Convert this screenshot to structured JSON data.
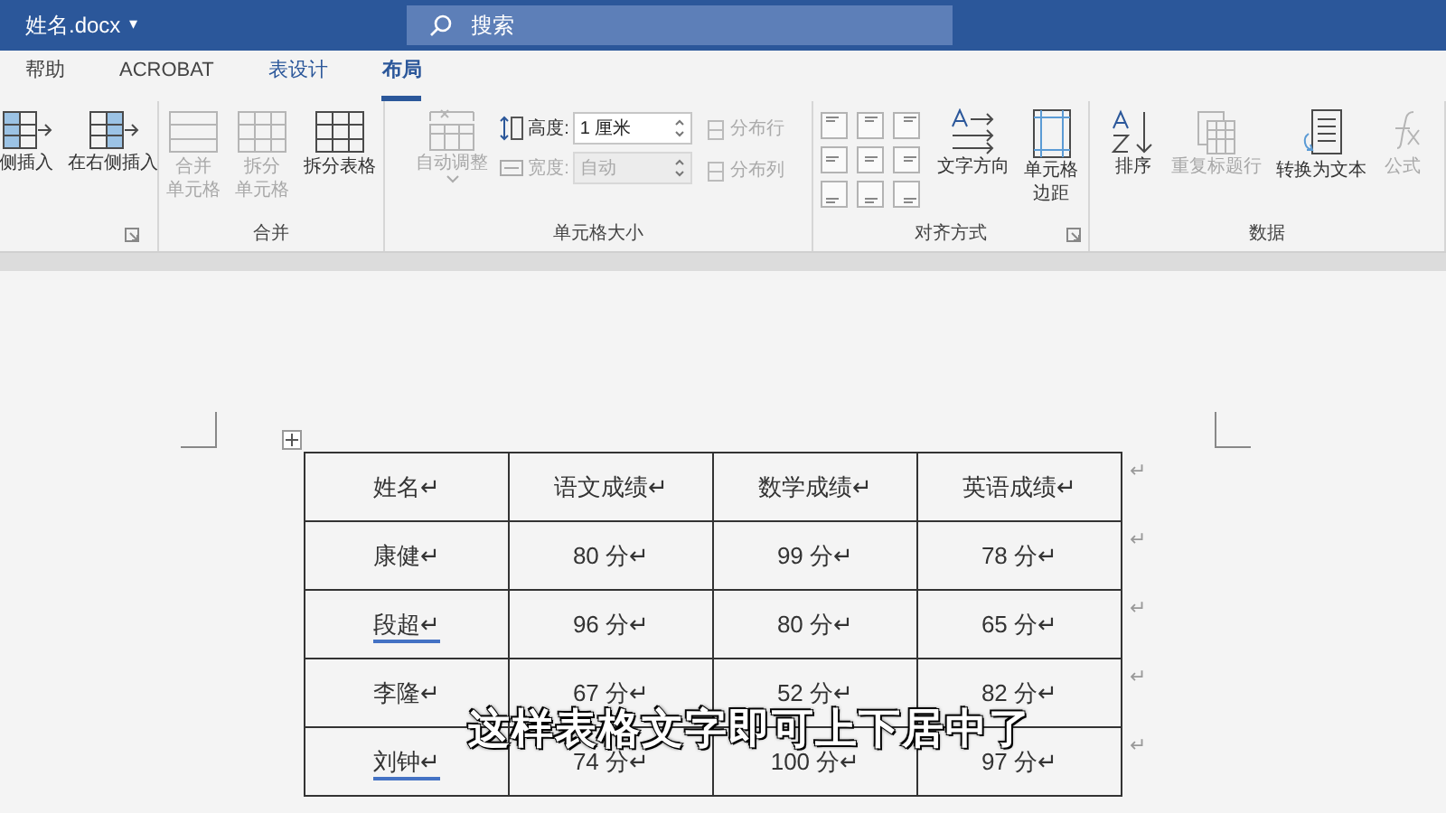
{
  "window": {
    "title": "姓名.docx",
    "title_caret": "▾",
    "search": {
      "placeholder": "搜索"
    }
  },
  "tabs": [
    {
      "label": "帮助",
      "selected": false,
      "contextual": false
    },
    {
      "label": "ACROBAT",
      "selected": false,
      "contextual": false
    },
    {
      "label": "表设计",
      "selected": false,
      "contextual": true
    },
    {
      "label": "布局",
      "selected": true,
      "contextual": true
    }
  ],
  "ribbon": {
    "groups": [
      {
        "launcher": true,
        "items": [
          {
            "kind": "large",
            "lines": [
              "侧插入"
            ],
            "disabled": false
          },
          {
            "kind": "large",
            "lines": [
              "在右侧插入"
            ],
            "disabled": false
          }
        ]
      },
      {
        "label": "合并",
        "launcher": false,
        "items": [
          {
            "kind": "large",
            "lines": [
              "合并",
              "单元格"
            ],
            "disabled": true
          },
          {
            "kind": "large",
            "lines": [
              "拆分",
              "单元格"
            ],
            "disabled": true
          },
          {
            "kind": "large",
            "lines": [
              "拆分表格"
            ],
            "disabled": false
          }
        ]
      },
      {
        "label": "单元格大小",
        "launcher": false,
        "items": [
          {
            "kind": "large",
            "lines": [
              "自动调整"
            ],
            "disabled": true,
            "caret": true
          },
          {
            "kind": "fields",
            "rows": [
              {
                "label": "高度:",
                "value": "1 厘米",
                "disabled": false
              },
              {
                "label": "宽度:",
                "value": "自动",
                "disabled": true
              }
            ]
          },
          {
            "kind": "small",
            "rows": [
              {
                "label": "分布行",
                "disabled": true
              },
              {
                "label": "分布列",
                "disabled": true
              }
            ]
          }
        ]
      },
      {
        "label": "对齐方式",
        "launcher": true,
        "items": [
          {
            "kind": "align"
          },
          {
            "kind": "large",
            "lines": [
              "文字方向"
            ],
            "disabled": false
          },
          {
            "kind": "large",
            "lines": [
              "单元格",
              "边距"
            ],
            "disabled": false
          }
        ]
      },
      {
        "label": "数据",
        "launcher": false,
        "items": [
          {
            "kind": "large",
            "lines": [
              "排序"
            ],
            "disabled": false
          },
          {
            "kind": "large",
            "lines": [
              "重复标题行"
            ],
            "disabled": true
          },
          {
            "kind": "large",
            "lines": [
              "转换为文本"
            ],
            "disabled": false
          },
          {
            "kind": "large",
            "lines": [
              "公式"
            ],
            "disabled": true
          }
        ]
      }
    ]
  },
  "table": {
    "rows": [
      {
        "cells": [
          {
            "text": "姓名↵",
            "flagged": false
          },
          {
            "text": "语文成绩↵",
            "flagged": false
          },
          {
            "text": "数学成绩↵",
            "flagged": false
          },
          {
            "text": "英语成绩↵",
            "flagged": false
          }
        ],
        "end_mark": "↵"
      },
      {
        "cells": [
          {
            "text": "康健↵",
            "flagged": false
          },
          {
            "text": "80 分↵",
            "flagged": false
          },
          {
            "text": "99 分↵",
            "flagged": false
          },
          {
            "text": "78 分↵",
            "flagged": false
          }
        ],
        "end_mark": "↵"
      },
      {
        "cells": [
          {
            "text": "段超↵",
            "flagged": true
          },
          {
            "text": "96 分↵",
            "flagged": false
          },
          {
            "text": "80 分↵",
            "flagged": false
          },
          {
            "text": "65 分↵",
            "flagged": false
          }
        ],
        "end_mark": "↵"
      },
      {
        "cells": [
          {
            "text": "李隆↵",
            "flagged": false
          },
          {
            "text": "67 分↵",
            "flagged": false
          },
          {
            "text": "52 分↵",
            "flagged": false
          },
          {
            "text": "82 分↵",
            "flagged": false
          }
        ],
        "end_mark": "↵"
      },
      {
        "cells": [
          {
            "text": "刘钟↵",
            "flagged": true
          },
          {
            "text": "74 分↵",
            "flagged": false
          },
          {
            "text": "100 分↵",
            "flagged": false
          },
          {
            "text": "97 分↵",
            "flagged": false
          }
        ],
        "end_mark": "↵"
      }
    ]
  },
  "subtitle": "这样表格文字即可上下居中了"
}
